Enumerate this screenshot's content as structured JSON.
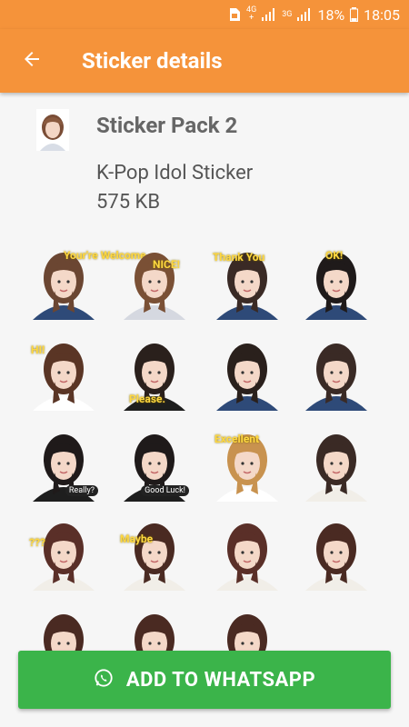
{
  "status_bar": {
    "net1_top": "4G",
    "net1_bottom": "+",
    "net2_top": "3G",
    "battery": "18%",
    "time": "18:05"
  },
  "app_bar": {
    "title": "Sticker details",
    "back_icon": "arrow-left-icon"
  },
  "pack": {
    "name": "Sticker Pack 2",
    "publisher": "K-Pop Idol Sticker",
    "size": "575 KB"
  },
  "stickers": [
    {
      "caption": "Your're Welcome",
      "tag": ""
    },
    {
      "caption": "NICE!",
      "tag": ""
    },
    {
      "caption": "Thank You",
      "tag": ""
    },
    {
      "caption": "OK!",
      "tag": ""
    },
    {
      "caption": "HI!",
      "tag": ""
    },
    {
      "caption": "Please.",
      "tag": ""
    },
    {
      "caption": "",
      "tag": ""
    },
    {
      "caption": "",
      "tag": ""
    },
    {
      "caption": "",
      "tag": "Really?"
    },
    {
      "caption": "",
      "tag": "Good Luck!"
    },
    {
      "caption": "Excellent",
      "tag": ""
    },
    {
      "caption": "",
      "tag": ""
    },
    {
      "caption": "???",
      "tag": ""
    },
    {
      "caption": "Maybe",
      "tag": ""
    },
    {
      "caption": "",
      "tag": ""
    },
    {
      "caption": "",
      "tag": ""
    },
    {
      "caption": "",
      "tag": ""
    },
    {
      "caption": "",
      "tag": ""
    },
    {
      "caption": "",
      "tag": ""
    }
  ],
  "add_button": {
    "label": "ADD TO WHATSAPP",
    "icon": "whatsapp-icon"
  },
  "colors": {
    "appbar": "#F5933A",
    "button": "#3BB44A"
  }
}
